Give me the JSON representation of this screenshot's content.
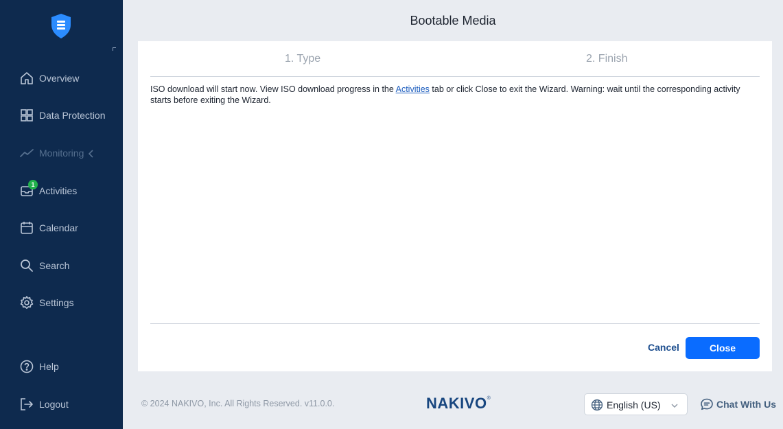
{
  "app": {
    "brand": "NAKIVO",
    "brand_mark": "®"
  },
  "sidebar": {
    "items": [
      {
        "label": "Overview"
      },
      {
        "label": "Data Protection"
      },
      {
        "label": "Monitoring"
      },
      {
        "label": "Activities",
        "badge": "1"
      },
      {
        "label": "Calendar"
      },
      {
        "label": "Search"
      },
      {
        "label": "Settings"
      },
      {
        "label": "Help"
      },
      {
        "label": "Logout"
      }
    ]
  },
  "dialog": {
    "title": "Bootable Media",
    "steps": [
      {
        "label": "1. Type"
      },
      {
        "label": "2. Finish"
      }
    ],
    "message": {
      "before_link": "ISO download will start now. View ISO download progress in the ",
      "link": "Activities",
      "after_link": " tab or click Close to exit the Wizard. Warning: wait until the corresponding activity starts before exiting the Wizard."
    },
    "cancel_label": "Cancel",
    "close_label": "Close"
  },
  "footer": {
    "copyright": "© 2024 NAKIVO, Inc. All Rights Reserved. v11.0.0.",
    "language": "English (US)",
    "chat_label": "Chat With Us"
  },
  "colors": {
    "sidebar_bg": "#0e2a4e",
    "accent": "#0a6cff",
    "badge": "#22b14c",
    "link": "#1f5fbf"
  }
}
